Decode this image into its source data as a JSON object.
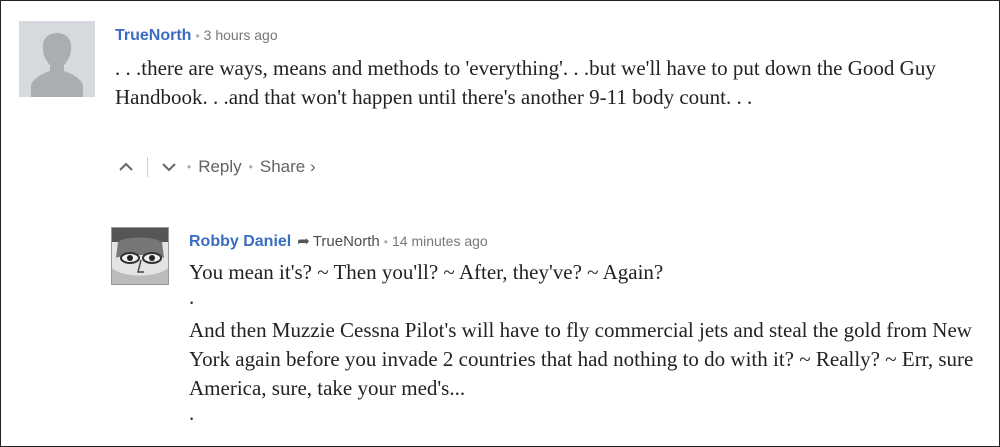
{
  "comments": [
    {
      "author": "TrueNorth",
      "time": "3 hours ago",
      "body": ". . .there are ways, means and methods to 'everything'. . .but we'll have to put down the Good Guy Handbook. . .and that won't happen until there's another 9-11 body count. . .",
      "actions": {
        "reply_label": "Reply",
        "share_label": "Share ›"
      }
    },
    {
      "author": "Robby Daniel",
      "reply_to": "TrueNorth",
      "time": "14 minutes ago",
      "paragraphs": [
        "You mean it's? ~ Then you'll? ~ After, they've? ~ Again?",
        ".",
        "And then Muzzie Cessna Pilot's will have to fly commercial jets and steal the gold from New York again before you invade 2 countries that had nothing to do with it? ~ Really? ~ Err, sure America, sure, take your med's...",
        "."
      ]
    }
  ]
}
